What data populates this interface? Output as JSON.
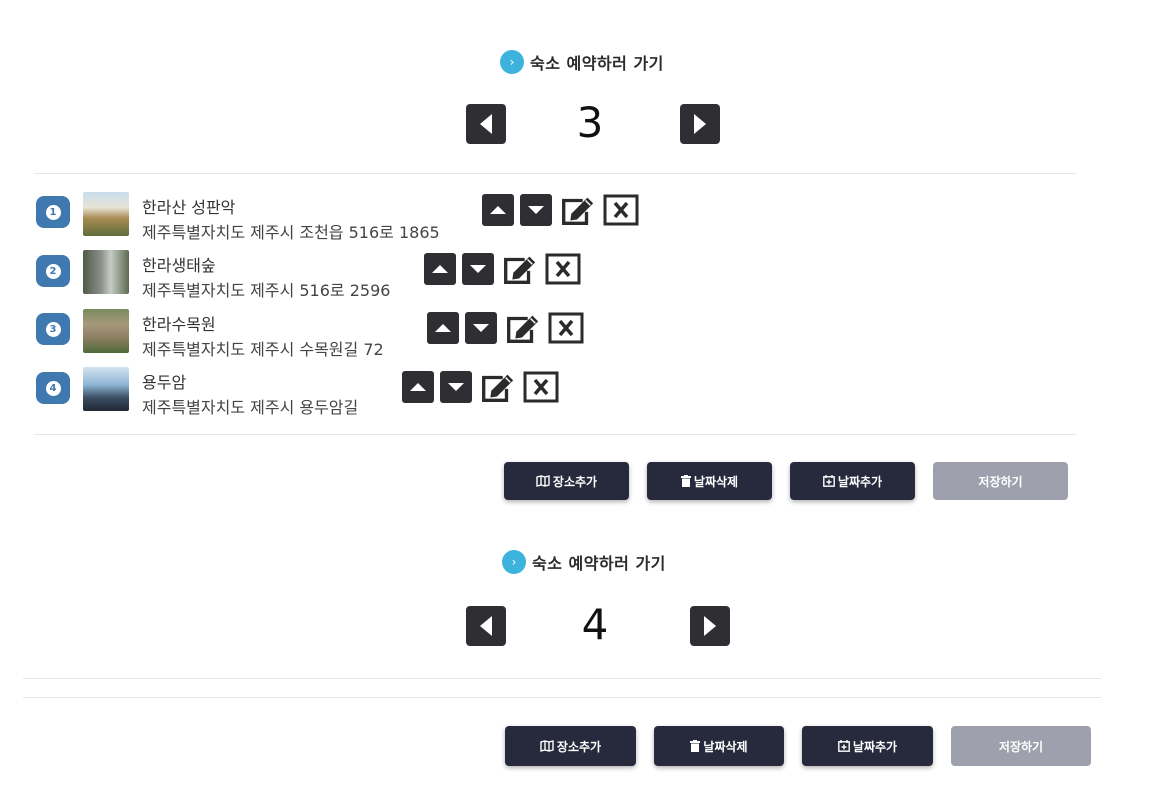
{
  "day_sections": [
    {
      "hotel_link": "숙소 예약하러 가기",
      "day_number": "3",
      "places": [
        {
          "index": "1",
          "name": "한라산 성판악",
          "address": "제주특별자치도 제주시 조천읍 516로 1865"
        },
        {
          "index": "2",
          "name": "한라생태숲",
          "address": "제주특별자치도 제주시 516로 2596"
        },
        {
          "index": "3",
          "name": "한라수목원",
          "address": "제주특별자치도 제주시 수목원길 72"
        },
        {
          "index": "4",
          "name": "용두암",
          "address": "제주특별자치도 제주시 용두암길"
        }
      ],
      "actions": {
        "add_place": "장소추가",
        "delete_date": "날짜삭제",
        "add_date": "날짜추가",
        "save": "저장하기"
      }
    },
    {
      "hotel_link": "숙소 예약하러 가기",
      "day_number": "4",
      "places": [],
      "actions": {
        "add_place": "장소추가",
        "delete_date": "날짜삭제",
        "add_date": "날짜추가",
        "save": "저장하기"
      }
    }
  ],
  "icons": {
    "hotel_link": "chevron-right-icon",
    "prev": "caret-left-icon",
    "next": "caret-right-icon",
    "move_up": "caret-up-icon",
    "move_down": "caret-down-icon",
    "edit": "edit-icon",
    "delete": "close-box-icon",
    "add_place": "map-icon",
    "delete_date": "trash-icon",
    "add_date": "calendar-plus-icon"
  },
  "colors": {
    "accent": "#3bb3dd",
    "badge": "#3f79b0",
    "button_dark": "#272a3d",
    "button_disabled": "#9ea1ad",
    "nav_button": "#2f2f33"
  }
}
